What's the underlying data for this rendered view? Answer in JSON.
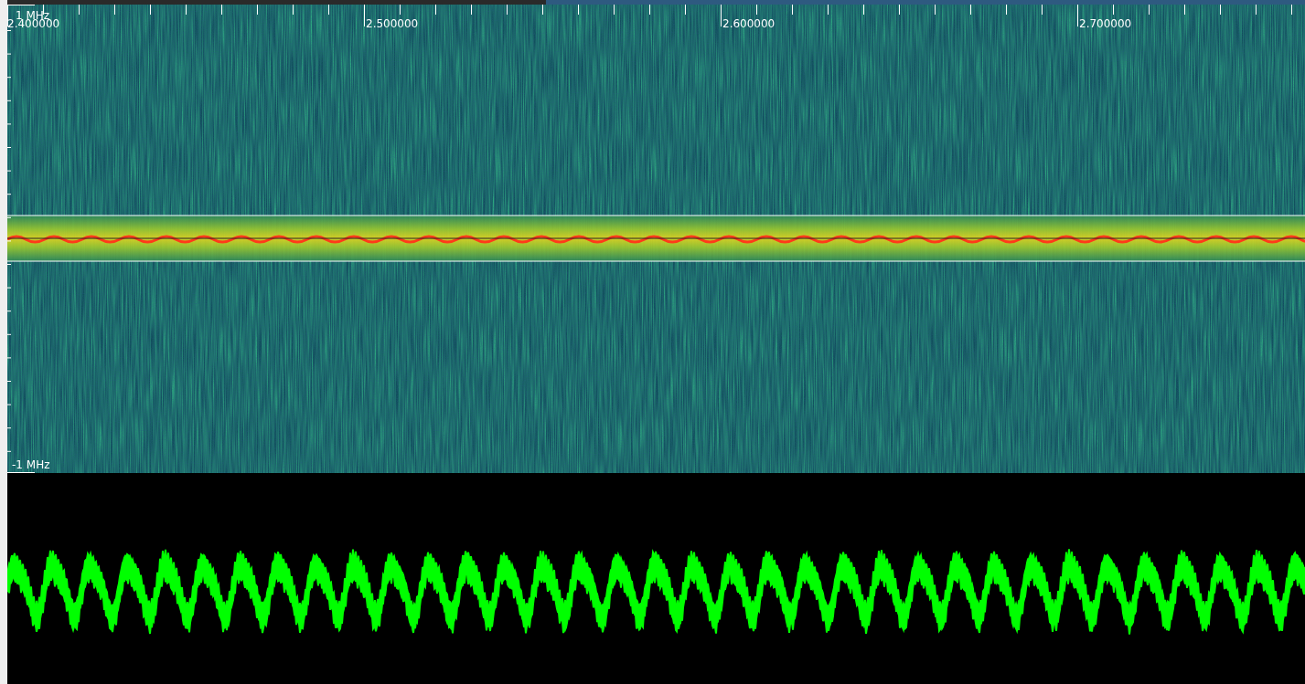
{
  "time_axis": {
    "labels": [
      "2.400000",
      "2.500000",
      "2.600000",
      "2.700000"
    ]
  },
  "frequency_scale": {
    "top": "1 MHz",
    "bottom": "-1 MHz"
  }
}
